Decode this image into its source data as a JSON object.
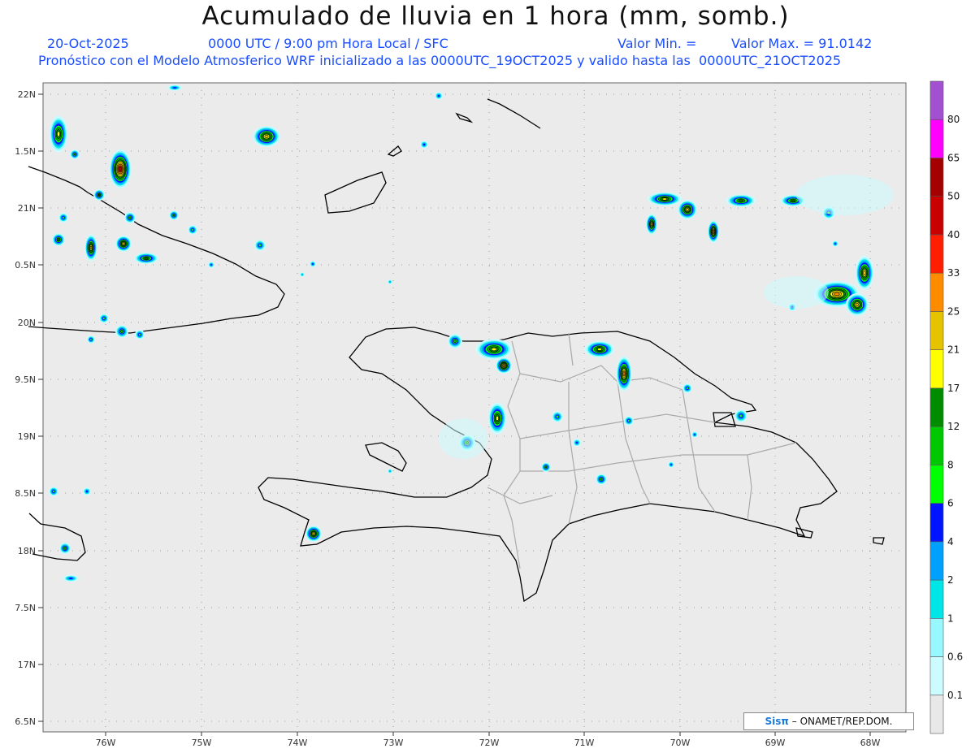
{
  "header": {
    "title": "Acumulado de lluvia en 1 hora (mm, somb.)",
    "date": "20-Oct-2025",
    "valid_time": "0000 UTC / 9:00 pm Hora Local / SFC",
    "min_label": "Valor Min. =",
    "max_label": "Valor Max. = 91.0142",
    "model_info": "Pronóstico con el Modelo Atmosferico WRF inicializado a las 0000UTC_19OCT2025 y valido hasta las  0000UTC_21OCT2025"
  },
  "axes": {
    "lat_labels": [
      "22N",
      "1.5N",
      "21N",
      "0.5N",
      "20N",
      "9.5N",
      "19N",
      "8.5N",
      "18N",
      "7.5N",
      "17N",
      "6.5N"
    ],
    "lon_labels": [
      "76W",
      "75W",
      "74W",
      "73W",
      "72W",
      "71W",
      "70W",
      "69W",
      "68W"
    ]
  },
  "colorbar": {
    "labels": [
      "0.1",
      "0.6",
      "1",
      "2",
      "4",
      "6",
      "8",
      "12",
      "17",
      "21",
      "25",
      "33",
      "40",
      "50",
      "65",
      "80"
    ],
    "colors": [
      "#e8e8e8",
      "#ccfcff",
      "#99f8ff",
      "#00e6e6",
      "#00a0ff",
      "#0014ff",
      "#00ff00",
      "#00c800",
      "#008c00",
      "#ffff00",
      "#e6c300",
      "#ff8c00",
      "#ff1e00",
      "#c80000",
      "#a50000",
      "#ff00ff",
      "#a050d0"
    ]
  },
  "credit": {
    "brand": "Sisπ",
    "text": "– ONAMET/REP.DOM."
  },
  "colors": {
    "background": "#ebebeb",
    "coast": "#000000",
    "provinces": "#aaaaaa",
    "header_blue": "#1a4dff"
  }
}
